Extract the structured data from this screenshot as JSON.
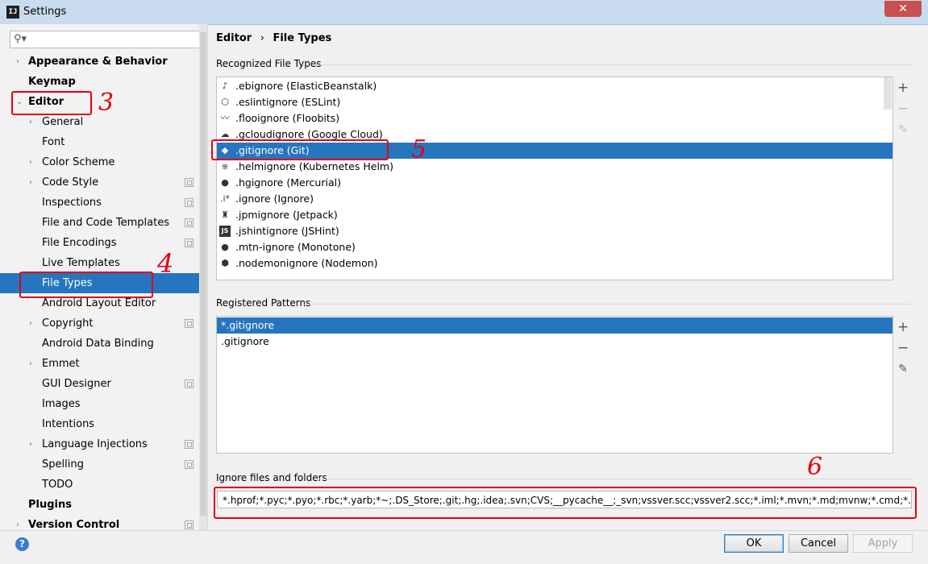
{
  "window": {
    "title": "Settings",
    "close_glyph": "✕",
    "app_icon": "IJ"
  },
  "search": {
    "placeholder": "",
    "icon": "search-icon"
  },
  "tree": [
    {
      "label": "Appearance & Behavior",
      "bold": true,
      "arrow": "›",
      "level": 0
    },
    {
      "label": "Keymap",
      "bold": true,
      "arrow": "",
      "level": 0
    },
    {
      "label": "Editor",
      "bold": true,
      "arrow": "⌄",
      "level": 0
    },
    {
      "label": "General",
      "arrow": "›",
      "level": 1
    },
    {
      "label": "Font",
      "arrow": "",
      "level": 1
    },
    {
      "label": "Color Scheme",
      "arrow": "›",
      "level": 1
    },
    {
      "label": "Code Style",
      "arrow": "›",
      "level": 1,
      "copy": true
    },
    {
      "label": "Inspections",
      "arrow": "",
      "level": 1,
      "copy": true
    },
    {
      "label": "File and Code Templates",
      "arrow": "",
      "level": 1,
      "copy": true
    },
    {
      "label": "File Encodings",
      "arrow": "",
      "level": 1,
      "copy": true
    },
    {
      "label": "Live Templates",
      "arrow": "",
      "level": 1
    },
    {
      "label": "File Types",
      "arrow": "",
      "level": 1,
      "selected": true
    },
    {
      "label": "Android Layout Editor",
      "arrow": "",
      "level": 1
    },
    {
      "label": "Copyright",
      "arrow": "›",
      "level": 1,
      "copy": true
    },
    {
      "label": "Android Data Binding",
      "arrow": "",
      "level": 1
    },
    {
      "label": "Emmet",
      "arrow": "›",
      "level": 1
    },
    {
      "label": "GUI Designer",
      "arrow": "",
      "level": 1,
      "copy": true
    },
    {
      "label": "Images",
      "arrow": "",
      "level": 1
    },
    {
      "label": "Intentions",
      "arrow": "",
      "level": 1
    },
    {
      "label": "Language Injections",
      "arrow": "›",
      "level": 1,
      "copy": true
    },
    {
      "label": "Spelling",
      "arrow": "",
      "level": 1,
      "copy": true
    },
    {
      "label": "TODO",
      "arrow": "",
      "level": 1
    },
    {
      "label": "Plugins",
      "bold": true,
      "arrow": "",
      "level": 0
    },
    {
      "label": "Version Control",
      "bold": true,
      "arrow": "›",
      "level": 0,
      "copy": true
    }
  ],
  "breadcrumb": {
    "part1": "Editor",
    "sep": "›",
    "part2": "File Types"
  },
  "recognized": {
    "label": "Recognized File Types",
    "items": [
      {
        "label": ".ebignore (ElasticBeanstalk)",
        "icon": "beanstalk-icon",
        "glyph": "♪",
        "color": "#333"
      },
      {
        "label": ".eslintignore (ESLint)",
        "icon": "eslint-icon",
        "glyph": "⬡",
        "color": "#333"
      },
      {
        "label": ".flooignore (Floobits)",
        "icon": "floobits-icon",
        "glyph": "〰",
        "color": "#333"
      },
      {
        "label": ".gcloudignore (Google Cloud)",
        "icon": "cloud-icon",
        "glyph": "☁",
        "color": "#333"
      },
      {
        "label": ".gitignore (Git)",
        "icon": "git-icon",
        "glyph": "◆",
        "color": "#f5f5f5",
        "selected": true
      },
      {
        "label": ".helmignore (Kubernetes Helm)",
        "icon": "helm-icon",
        "glyph": "⎈",
        "color": "#333"
      },
      {
        "label": ".hgignore (Mercurial)",
        "icon": "mercurial-icon",
        "glyph": "●",
        "color": "#333"
      },
      {
        "label": ".ignore (Ignore)",
        "icon": "ignore-icon",
        "glyph": ".i*",
        "color": "#333"
      },
      {
        "label": ".jpmignore (Jetpack)",
        "icon": "jetpack-icon",
        "glyph": "♜",
        "color": "#333"
      },
      {
        "label": ".jshintignore (JSHint)",
        "icon": "jshint-icon",
        "glyph": "JS",
        "color": "#fff"
      },
      {
        "label": ".mtn-ignore (Monotone)",
        "icon": "monotone-icon",
        "glyph": "●",
        "color": "#333"
      },
      {
        "label": ".nodemonignore (Nodemon)",
        "icon": "nodemon-icon",
        "glyph": "⬢",
        "color": "#333"
      }
    ]
  },
  "patterns": {
    "label": "Registered Patterns",
    "items": [
      {
        "label": "*.gitignore",
        "selected": true
      },
      {
        "label": ".gitignore"
      }
    ]
  },
  "toolbar": {
    "add": "+",
    "remove": "−",
    "edit": "✎"
  },
  "ignore": {
    "label": "Ignore files and folders",
    "value": "*.hprof;*.pyc;*.pyo;*.rbc;*.yarb;*~;.DS_Store;.git;.hg;.idea;.svn;CVS;__pycache__;_svn;vssver.scc;vssver2.scc;*.iml;*.mvn;*.md;mvnw;*.cmd;*.gitignore;"
  },
  "buttons": {
    "help": "?",
    "ok": "OK",
    "cancel": "Cancel",
    "apply": "Apply"
  },
  "annotations": {
    "a3": "3",
    "a4": "4",
    "a5": "5",
    "a6": "6"
  },
  "colors": {
    "selection": "#2675bf",
    "annotation": "#e60012"
  }
}
